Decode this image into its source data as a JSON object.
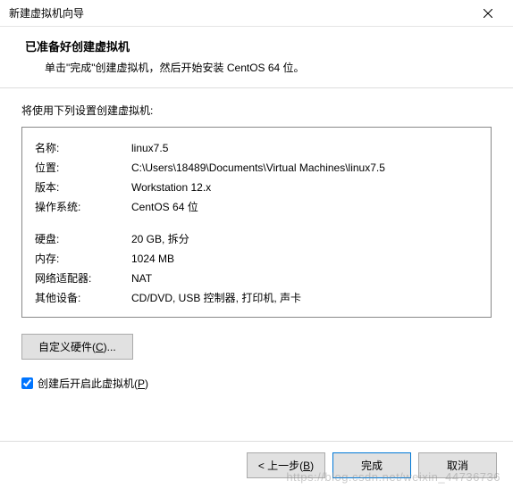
{
  "window": {
    "title": "新建虚拟机向导"
  },
  "header": {
    "title": "已准备好创建虚拟机",
    "subtitle": "单击\"完成\"创建虚拟机，然后开始安装 CentOS 64 位。"
  },
  "intro": "将使用下列设置创建虚拟机:",
  "settings": {
    "name_label": "名称:",
    "name_value": "linux7.5",
    "location_label": "位置:",
    "location_value": "C:\\Users\\18489\\Documents\\Virtual Machines\\linux7.5",
    "version_label": "版本:",
    "version_value": "Workstation 12.x",
    "os_label": "操作系统:",
    "os_value": "CentOS 64 位",
    "disk_label": "硬盘:",
    "disk_value": "20 GB, 拆分",
    "memory_label": "内存:",
    "memory_value": "1024 MB",
    "net_label": "网络适配器:",
    "net_value": "NAT",
    "other_label": "其他设备:",
    "other_value": "CD/DVD, USB 控制器, 打印机, 声卡"
  },
  "custom_hw_label_pre": "自定义硬件(",
  "custom_hw_key": "C",
  "custom_hw_label_post": ")...",
  "checkbox": {
    "label_pre": "创建后开启此虚拟机(",
    "label_key": "P",
    "label_post": ")",
    "checked": true
  },
  "footer": {
    "back_pre": "< 上一步(",
    "back_key": "B",
    "back_post": ")",
    "finish": "完成",
    "cancel": "取消"
  },
  "watermark": "https://blog.csdn.net/weixin_44736736"
}
